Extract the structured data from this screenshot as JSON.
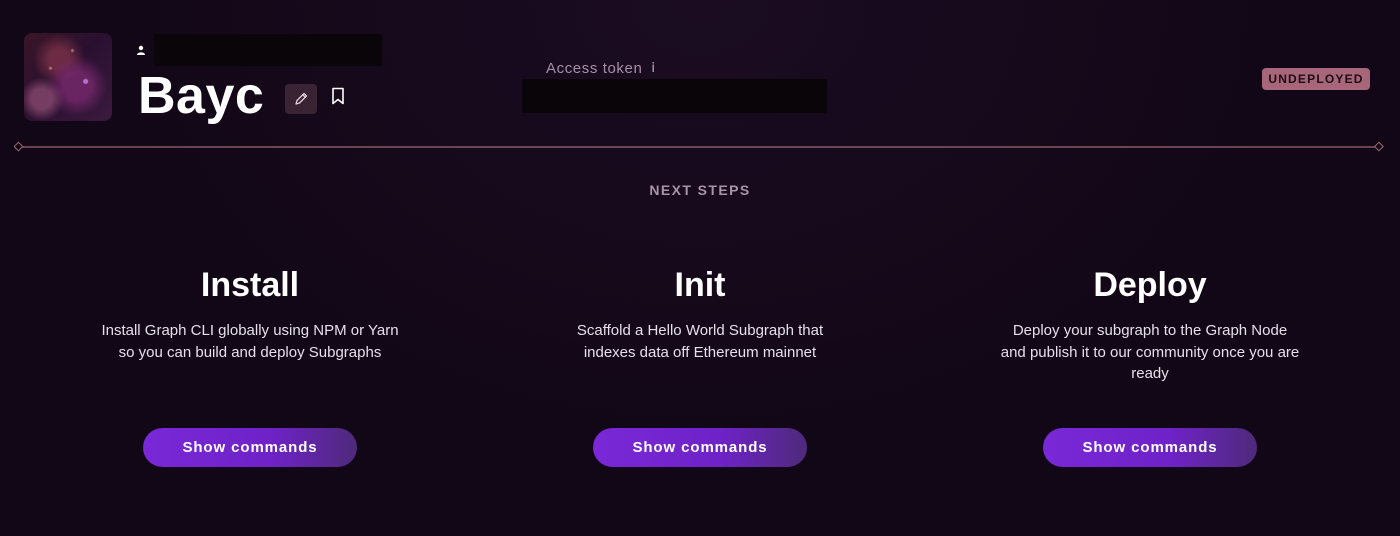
{
  "header": {
    "title": "Bayc",
    "access_token_label": "Access token",
    "info_glyph": "i",
    "status": "UNDEPLOYED"
  },
  "section_label": "NEXT STEPS",
  "steps": [
    {
      "title": "Install",
      "description": "Install Graph CLI globally using NPM or Yarn so you can build and deploy Subgraphs",
      "button_label": "Show commands"
    },
    {
      "title": "Init",
      "description": "Scaffold a Hello World Subgraph that indexes data off Ethereum mainnet",
      "button_label": "Show commands"
    },
    {
      "title": "Deploy",
      "description": "Deploy your subgraph to the Graph Node and publish it to our community once you are ready",
      "button_label": "Show commands"
    }
  ],
  "icons": {
    "owner": "person-icon",
    "edit": "pencil-icon",
    "bookmark": "bookmark-icon",
    "info": "info-icon"
  },
  "colors": {
    "background": "#120716",
    "accent_button": "#7a28d8",
    "status_badge": "#a8667a",
    "divider": "#9c6a72"
  }
}
